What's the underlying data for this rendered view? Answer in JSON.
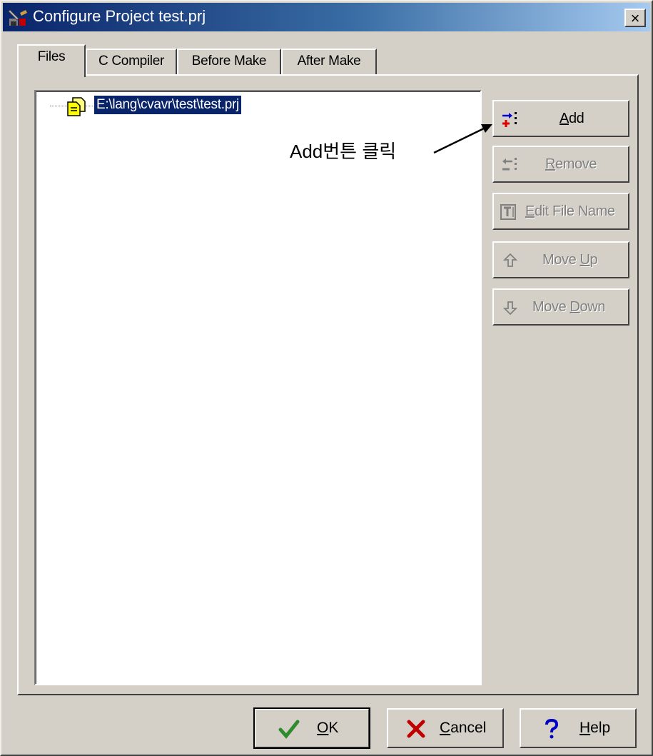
{
  "window": {
    "title": "Configure Project test.prj",
    "close_label": "×"
  },
  "tabs": [
    {
      "label": "Files",
      "active": true
    },
    {
      "label": "C Compiler",
      "active": false
    },
    {
      "label": "Before Make",
      "active": false
    },
    {
      "label": "After Make",
      "active": false
    }
  ],
  "tree": {
    "items": [
      {
        "label": "E:\\lang\\cvavr\\test\\test.prj",
        "selected": true,
        "icon": "project-file-icon"
      }
    ]
  },
  "side_buttons": [
    {
      "label": "Add",
      "mnemonic": "A",
      "enabled": true,
      "icon": "add-file-icon"
    },
    {
      "label": "Remove",
      "mnemonic": "R",
      "enabled": false,
      "icon": "remove-file-icon"
    },
    {
      "label": "Edit File Name",
      "mnemonic": "E",
      "enabled": false,
      "icon": "edit-name-icon"
    },
    {
      "label": "Move Up",
      "mnemonic": "U",
      "enabled": false,
      "icon": "arrow-up-icon"
    },
    {
      "label": "Move Down",
      "mnemonic": "D",
      "enabled": false,
      "icon": "arrow-down-icon"
    }
  ],
  "annotation": {
    "text": "Add번튼 클릭"
  },
  "footer_buttons": [
    {
      "label": "OK",
      "mnemonic": "O",
      "default": true,
      "icon": "checkmark-icon",
      "color": "#2e8b2e"
    },
    {
      "label": "Cancel",
      "mnemonic": "C",
      "default": false,
      "icon": "x-icon",
      "color": "#c00000"
    },
    {
      "label": "Help",
      "mnemonic": "H",
      "default": false,
      "icon": "question-icon",
      "color": "#0000c0"
    }
  ],
  "colors": {
    "titlebar_start": "#0a246a",
    "titlebar_end": "#a6caf0",
    "face": "#d4d0c8",
    "selection": "#0a246a"
  }
}
